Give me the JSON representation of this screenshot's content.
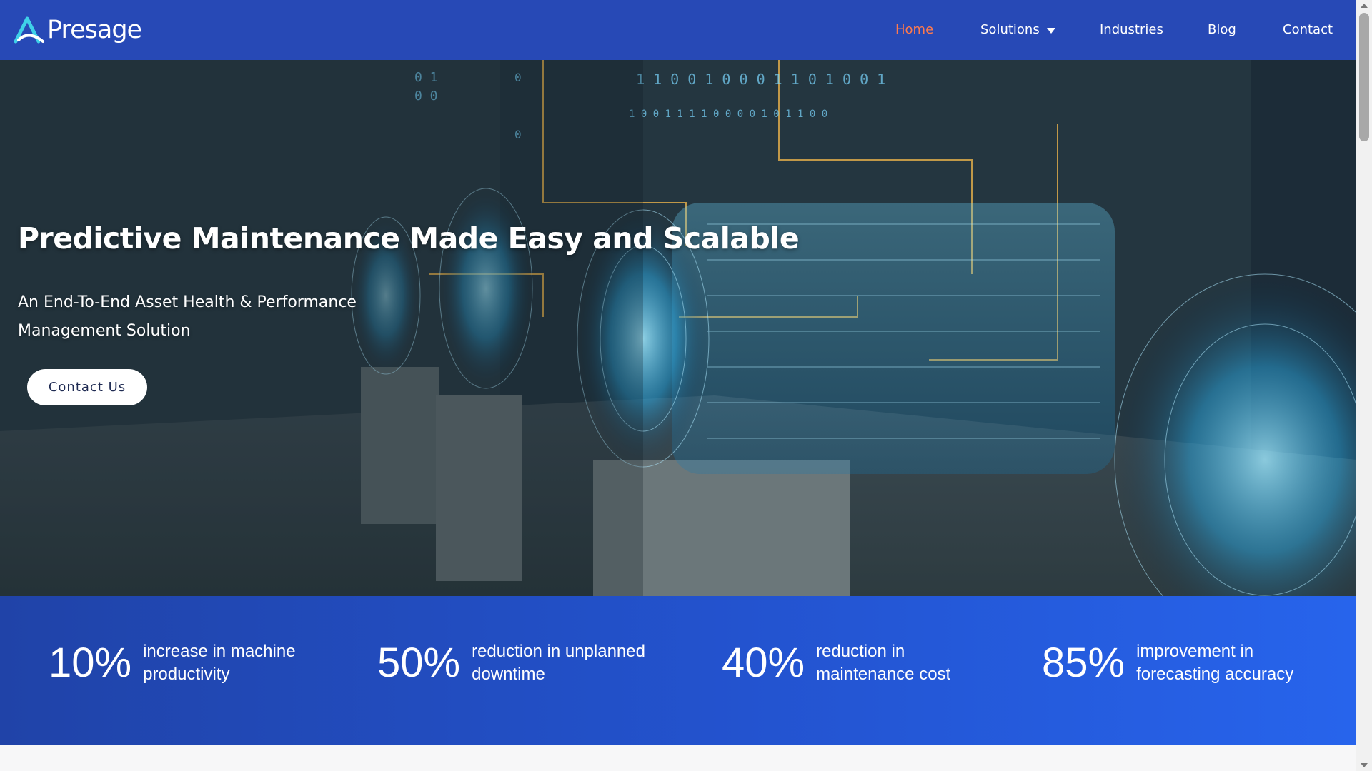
{
  "brand": {
    "name": "Presage"
  },
  "nav": {
    "items": [
      {
        "label": "Home",
        "active": true
      },
      {
        "label": "Solutions",
        "has_dropdown": true
      },
      {
        "label": "Industries"
      },
      {
        "label": "Blog"
      },
      {
        "label": "Contact"
      }
    ],
    "active_color": "#ff7a4d"
  },
  "hero": {
    "title": "Predictive Maintenance Made Easy and Scalable",
    "subtitle": "An End-To-End Asset Health & Performance Management Solution",
    "cta_label": "Contact Us"
  },
  "stats": [
    {
      "value": "10%",
      "label": "increase in machine productivity"
    },
    {
      "value": "50%",
      "label": "reduction in unplanned downtime"
    },
    {
      "value": "40%",
      "label": "reduction in maintenance cost"
    },
    {
      "value": "85%",
      "label": "improvement in forecasting accuracy"
    }
  ],
  "colors": {
    "header_bg": "#2749b6",
    "stats_bg_start": "#2043a8",
    "stats_bg_end": "#2764ec",
    "hero_glow": "#4fd1ff"
  }
}
